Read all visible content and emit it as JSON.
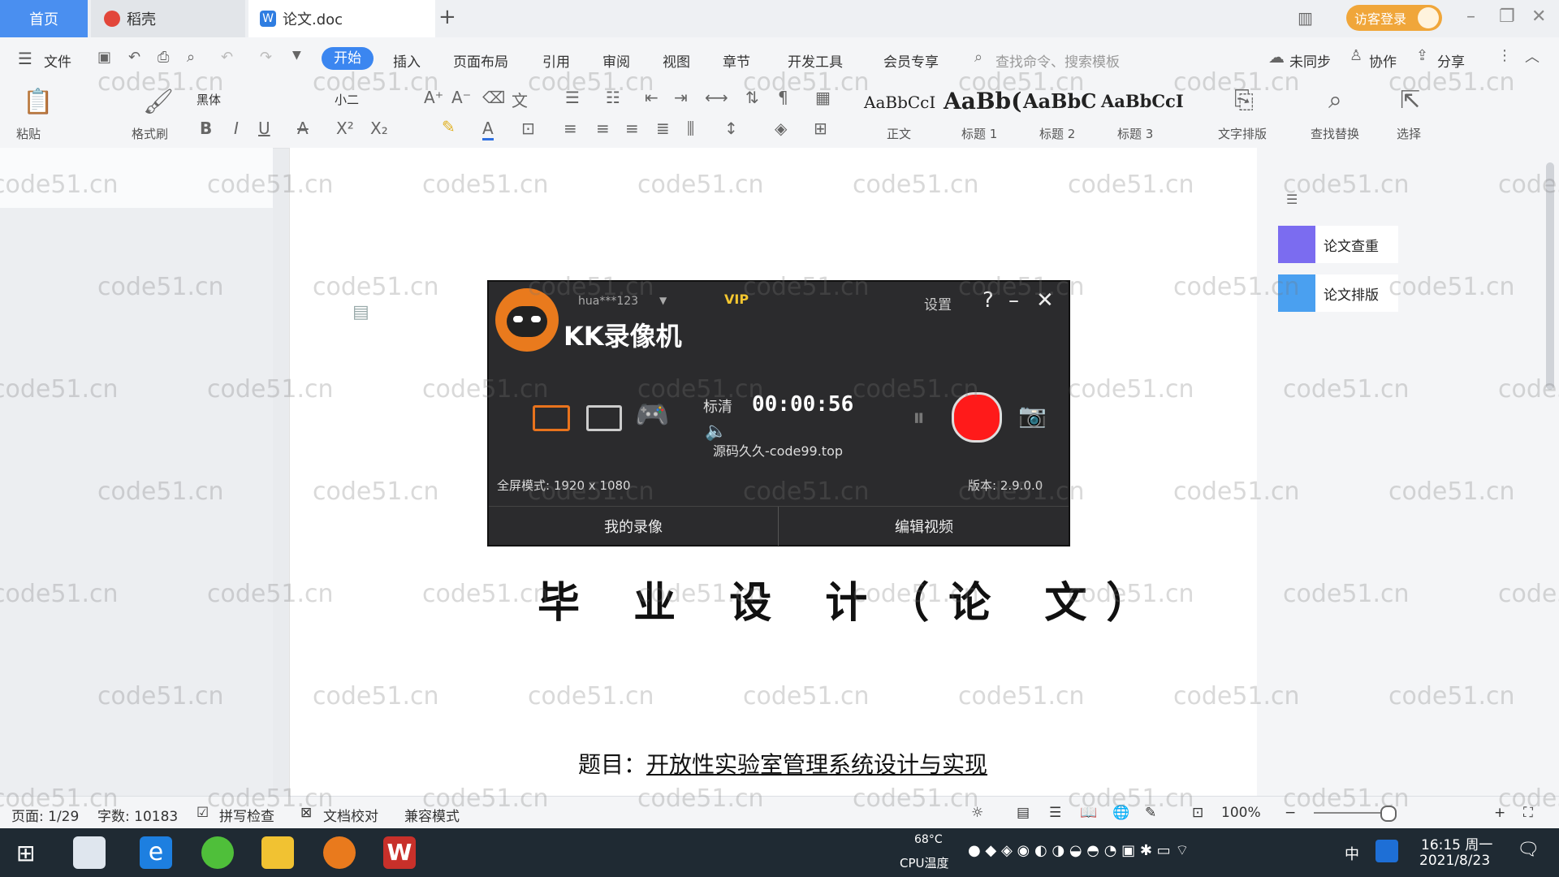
{
  "titlebar": {
    "tabs": [
      {
        "label": "首页"
      },
      {
        "label": "稻壳"
      },
      {
        "label": "论文.doc"
      }
    ],
    "login_label": "访客登录"
  },
  "menubar": {
    "file": "文件",
    "items": [
      "开始",
      "插入",
      "页面布局",
      "引用",
      "审阅",
      "视图",
      "章节",
      "开发工具",
      "会员专享"
    ],
    "search_cmd": "查找命令、搜索模板",
    "sync": "未同步",
    "collab": "协作",
    "share": "分享"
  },
  "ribbon": {
    "paste": "粘贴",
    "format_painter": "格式刷",
    "font": "黑体",
    "size": "小二",
    "styles": [
      {
        "sample": "AaBbCcI",
        "label": "正文"
      },
      {
        "sample": "AaBb(",
        "label": "标题 1"
      },
      {
        "sample": "AaBbC",
        "label": "标题 2"
      },
      {
        "sample": "AaBbCcI",
        "label": "标题 3"
      }
    ],
    "text_tools": "文字排版",
    "find_replace": "查找替换",
    "select": "选择"
  },
  "document": {
    "title": "毕 业 设 计（论 文）",
    "topic_label": "题目：",
    "topic_value": "开放性实验室管理系统设计与实现"
  },
  "right_panel": {
    "items": [
      {
        "label": "论文查重",
        "color": "#7b6cf0"
      },
      {
        "label": "论文排版",
        "color": "#4aa0f0"
      }
    ]
  },
  "recorder": {
    "app_name": "KK录像机",
    "user": "hua***123",
    "vip": "VIP",
    "settings": "设置",
    "help": "?",
    "minimize": "–",
    "close": "✕",
    "quality": "标清",
    "timer": "00:00:56",
    "watermark": "源码久久-code99.top",
    "fullscreen_mode": "全屏模式: 1920 x 1080",
    "version": "版本: 2.9.0.0",
    "my_recordings": "我的录像",
    "edit_video": "编辑视频"
  },
  "statusbar": {
    "page": "页面: 1/29",
    "words": "字数: 10183",
    "spell_check": "拼写检查",
    "doc_proof": "文档校对",
    "compat": "兼容模式",
    "zoom": "100%",
    "zoom_level": 0.9
  },
  "taskbar": {
    "cpu_temp": "68°C",
    "cpu_label": "CPU温度",
    "ime": "中",
    "time": "16:15 周一",
    "date": "2021/8/23"
  },
  "watermark_text": "code51.cn",
  "colors": {
    "accent": "#3b86f0",
    "record": "#ff1a1a",
    "login": "#f0a63a"
  }
}
